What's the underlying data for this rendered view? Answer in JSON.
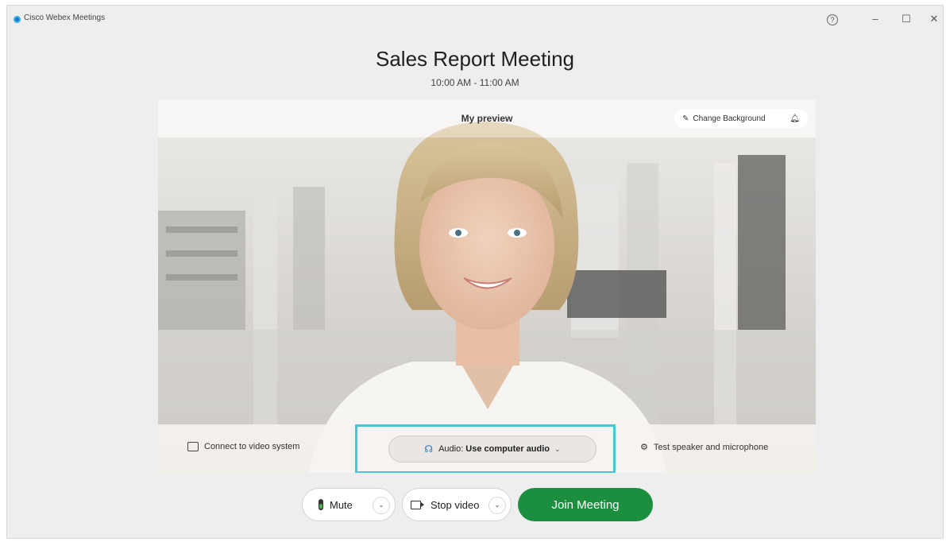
{
  "app": {
    "title": "Cisco Webex Meetings"
  },
  "window_controls": {
    "help": "?",
    "minimize": "–",
    "maximize": "☐",
    "close": "✕"
  },
  "meeting": {
    "title": "Sales Report Meeting",
    "time": "10:00 AM - 11:00 AM"
  },
  "preview": {
    "label": "My preview",
    "change_background": "Change Background",
    "connect_video": "Connect to video system",
    "audio_prefix": "Audio:",
    "audio_value": "Use computer audio",
    "test_speaker": "Test speaker and microphone"
  },
  "controls": {
    "mute_label": "Mute",
    "stop_video_label": "Stop video",
    "join_label": "Join Meeting"
  },
  "colors": {
    "join": "#1c8f3f",
    "highlight": "#4bc3d6",
    "audio_icon": "#2d74c4"
  }
}
